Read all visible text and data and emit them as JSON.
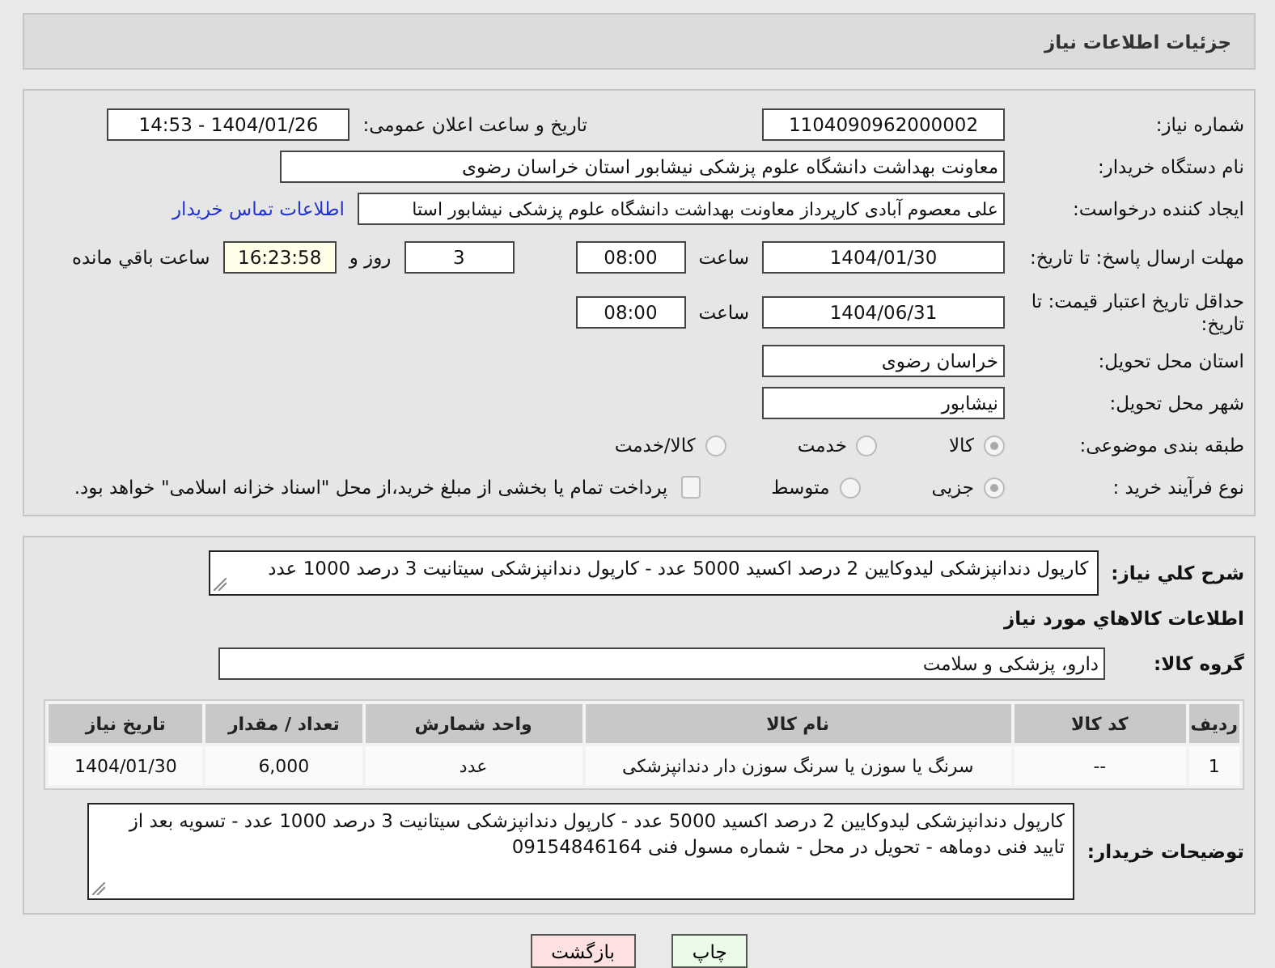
{
  "header": {
    "title": "جزئیات اطلاعات نیاز"
  },
  "need_number": {
    "label": "شماره نیاز:",
    "value": "1104090962000002"
  },
  "announce": {
    "label": "تاریخ و ساعت اعلان عمومی:",
    "value": "1404/01/26 - 14:53"
  },
  "buyer_org": {
    "label": "نام دستگاه خریدار:",
    "value": "معاونت بهداشت دانشگاه علوم پزشکی نیشابور استان خراسان رضوی"
  },
  "requester": {
    "label": "ایجاد کننده درخواست:",
    "value": "علی معصوم آبادی کارپرداز معاونت بهداشت دانشگاه علوم پزشکی نیشابور استا",
    "contact_link": "اطلاعات تماس خریدار"
  },
  "response_deadline": {
    "label": "مهلت ارسال پاسخ: تا تاریخ:",
    "date": "1404/01/30",
    "time_label": "ساعت",
    "time": "08:00",
    "days": "3",
    "days_label": "روز و",
    "remaining": "16:23:58",
    "remaining_label": "ساعت باقي مانده"
  },
  "price_validity": {
    "label": "حداقل تاریخ اعتبار قیمت: تا تاریخ:",
    "date": "1404/06/31",
    "time_label": "ساعت",
    "time": "08:00"
  },
  "province": {
    "label": "استان محل تحویل:",
    "value": "خراسان رضوی"
  },
  "city": {
    "label": "شهر محل تحویل:",
    "value": "نیشابور"
  },
  "category": {
    "label": "طبقه بندی موضوعی:",
    "options": [
      {
        "label": "کالا",
        "selected": true
      },
      {
        "label": "خدمت",
        "selected": false
      },
      {
        "label": "کالا/خدمت",
        "selected": false
      }
    ]
  },
  "process": {
    "label": "نوع فرآیند خرید :",
    "options": [
      {
        "label": "جزیی",
        "selected": true
      },
      {
        "label": "متوسط",
        "selected": false
      }
    ],
    "payment": {
      "label": "پرداخت تمام یا بخشی از مبلغ خرید،از محل \"اسناد خزانه اسلامی\" خواهد بود.",
      "checked": false
    }
  },
  "summary": {
    "label": "شرح کلي نياز:",
    "value": "کارپول دندانپزشکی لیدوکایین 2 درصد اکسید 5000 عدد - کارپول دندانپزشکی سیتانیت 3 درصد 1000 عدد"
  },
  "goods_heading": "اطلاعات کالاهاي مورد نياز",
  "goods_group": {
    "label": "گروه کالا:",
    "value": "دارو، پزشکی و سلامت"
  },
  "table": {
    "columns": [
      "ردیف",
      "کد کالا",
      "نام کالا",
      "واحد شمارش",
      "تعداد / مقدار",
      "تاریخ نیاز"
    ],
    "rows": [
      [
        "1",
        "--",
        "سرنگ یا سوزن یا سرنگ سوزن دار دندانپزشکی",
        "عدد",
        "6,000",
        "1404/01/30"
      ]
    ]
  },
  "buyer_notes": {
    "label": "توضیحات خریدار:",
    "value": "کارپول دندانپزشکی لیدوکایین 2 درصد اکسید 5000 عدد - کارپول دندانپزشکی سیتانیت 3 درصد 1000 عدد - تسویه بعد از تایید فنی دوماهه - تحویل در محل - شماره مسول فنی 09154846164"
  },
  "buttons": [
    {
      "label": "چاپ",
      "kind": "print"
    },
    {
      "label": "بازگشت",
      "kind": "back"
    }
  ]
}
